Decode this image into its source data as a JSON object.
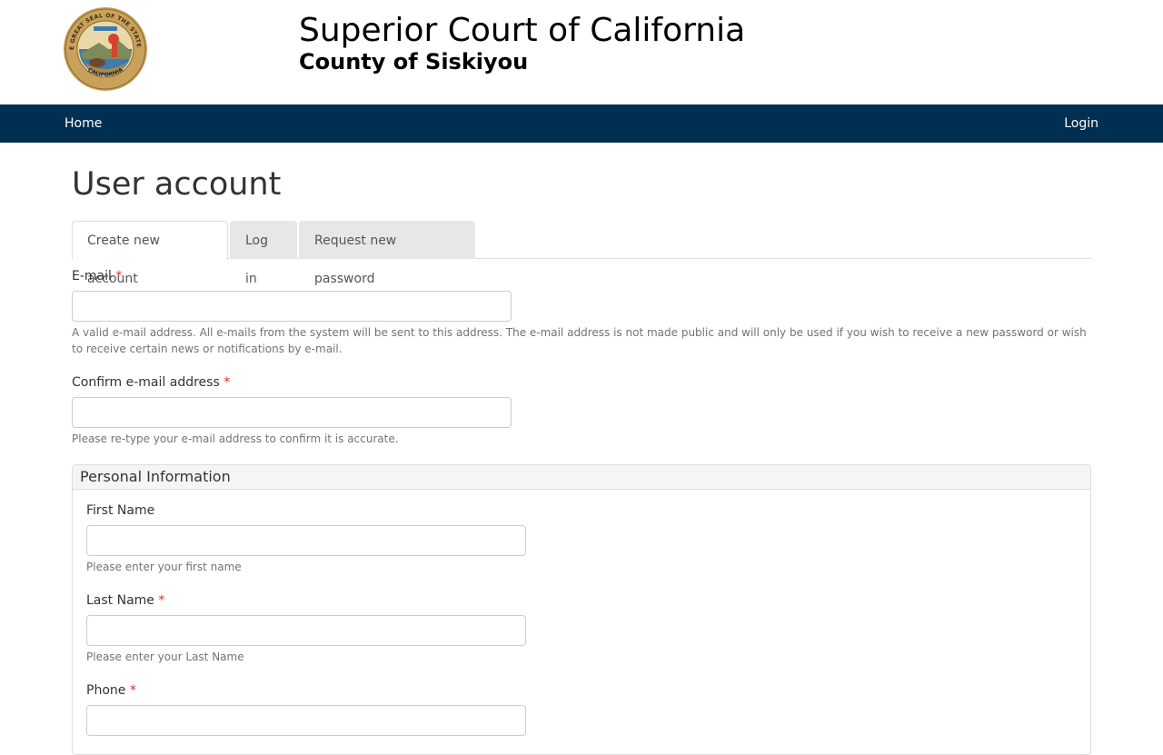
{
  "header": {
    "title": "Superior Court of California",
    "subtitle": "County of Siskiyou",
    "seal_text": "THE GREAT SEAL OF THE STATE OF CALIFORNIA",
    "seal_motto": "EUREKA"
  },
  "nav": {
    "home_label": "Home",
    "login_label": "Login",
    "background_color": "#002f52"
  },
  "page": {
    "title": "User account"
  },
  "tabs": [
    {
      "label": "Create new account",
      "active": true
    },
    {
      "label": "Log in",
      "active": false
    },
    {
      "label": "Request new password",
      "active": false
    }
  ],
  "form": {
    "required_marker": "*",
    "email": {
      "label": "E-mail",
      "value": "",
      "help": "A valid e-mail address. All e-mails from the system will be sent to this address. The e-mail address is not made public and will only be used if you wish to receive a new password or wish to receive certain news or notifications by e-mail."
    },
    "confirm_email": {
      "label": "Confirm e-mail address",
      "value": "",
      "help": "Please re-type your e-mail address to confirm it is accurate."
    },
    "personal_info": {
      "legend": "Personal Information",
      "first_name": {
        "label": "First Name",
        "value": "",
        "help": "Please enter your first name"
      },
      "last_name": {
        "label": "Last Name",
        "value": "",
        "help": "Please enter your Last Name"
      },
      "phone": {
        "label": "Phone",
        "value": ""
      }
    }
  }
}
